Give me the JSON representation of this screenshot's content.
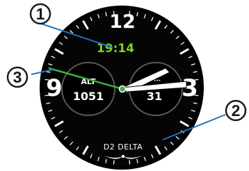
{
  "watch_face": {
    "digital_time": "19:14",
    "hour_markers": {
      "twelve": "12",
      "three": "3",
      "nine": "9"
    },
    "left_subdial": {
      "label": "ALT",
      "value": "1051"
    },
    "right_subdial": {
      "label": "···",
      "value": "31"
    },
    "brand": "D2 DELTA"
  },
  "callouts": [
    {
      "number": "1"
    },
    {
      "number": "2"
    },
    {
      "number": "3"
    }
  ],
  "colors": {
    "face": "#000000",
    "digital_time": "#7ed321",
    "callout_line": "#1e73be",
    "green_hand": "#3cb043",
    "marker": "#ffffff"
  }
}
